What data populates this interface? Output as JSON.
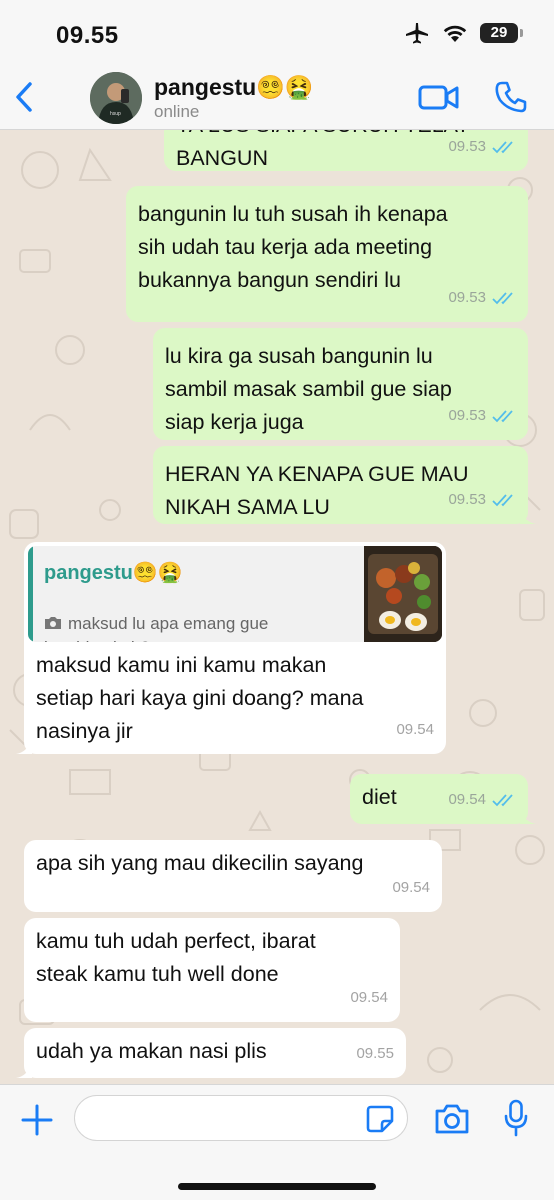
{
  "status_bar": {
    "time": "09.55",
    "battery": "29"
  },
  "header": {
    "contact_name": "pangestu",
    "contact_emoji": "😵‍💫🤮",
    "contact_status": "online"
  },
  "messages": [
    {
      "id": "m1",
      "direction": "out",
      "text": "YA LUS SIAPA SURUH TELAT\nBANGUN",
      "time": "09.53",
      "read": true
    },
    {
      "id": "m2",
      "direction": "out",
      "text": "bangunin lu tuh susah ih kenapa\nsih udah tau kerja ada meeting\nbukannya bangun sendiri lu",
      "time": "09.53",
      "read": true
    },
    {
      "id": "m3",
      "direction": "out",
      "text": "lu kira ga susah bangunin lu\nsambil masak sambil gue siap\nsiap kerja juga",
      "time": "09.53",
      "read": true
    },
    {
      "id": "m4",
      "direction": "out",
      "text": "HERAN YA KENAPA GUE MAU\nNIKAH SAMA LU",
      "time": "09.53",
      "read": true
    },
    {
      "id": "m5",
      "direction": "in",
      "text": "maksud kamu ini kamu makan\nsetiap hari kaya gini doang? mana\nnasinya jir",
      "time": "09.54",
      "quote": {
        "name": "pangestu",
        "emoji": "😵‍💫🤮",
        "text": "maksud lu apa emang gue\nkambing kah?",
        "icon": "camera-icon"
      }
    },
    {
      "id": "m6",
      "direction": "out",
      "text": "diet",
      "time": "09.54",
      "read": true
    },
    {
      "id": "m7",
      "direction": "in",
      "text": "apa sih yang mau dikecilin sayang",
      "time": "09.54"
    },
    {
      "id": "m8",
      "direction": "in",
      "text": "kamu tuh udah perfect, ibarat\nsteak kamu tuh well done",
      "time": "09.54"
    },
    {
      "id": "m9",
      "direction": "in",
      "text": "udah ya makan nasi plis",
      "time": "09.55"
    }
  ],
  "input": {
    "placeholder": ""
  },
  "colors": {
    "accent": "#1a7cf5",
    "outgoing_bubble": "#dcf8c6",
    "incoming_bubble": "#ffffff",
    "read_ticks": "#53bdeb",
    "quote_accent": "#2e9b8c"
  }
}
